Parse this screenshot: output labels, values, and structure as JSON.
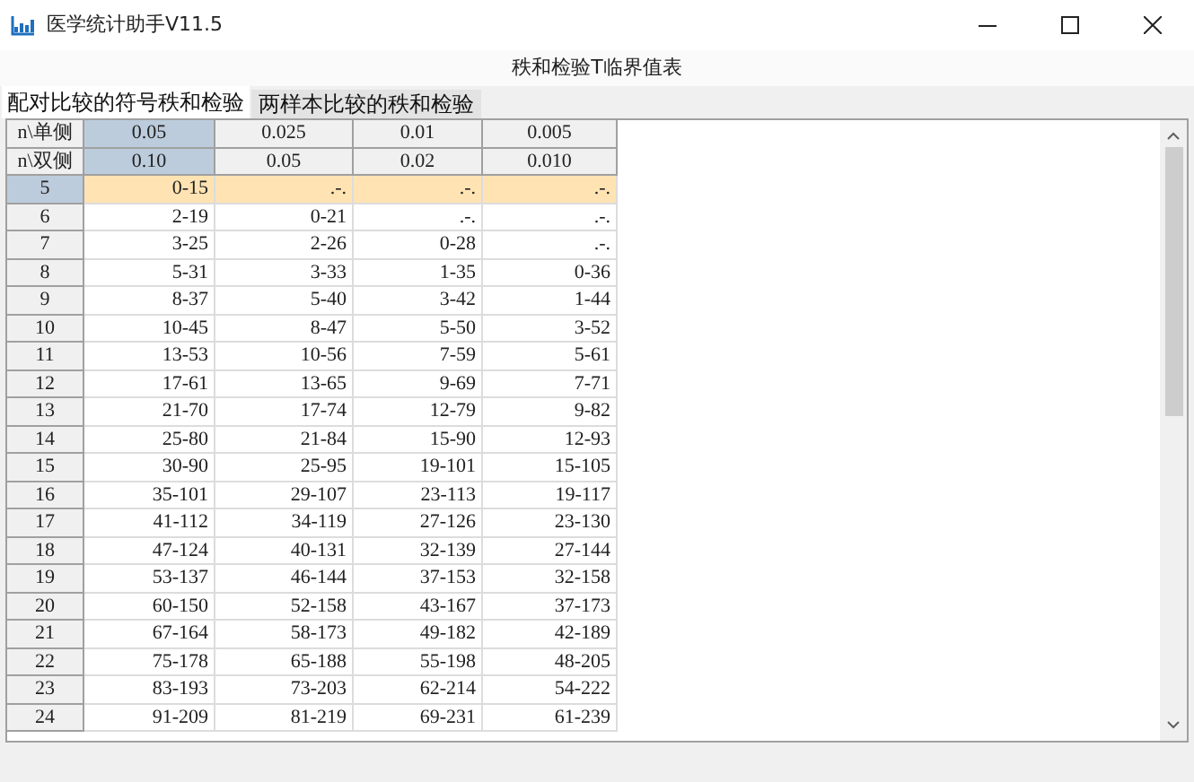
{
  "window": {
    "title": "医学统计助手V11.5"
  },
  "heading": "秩和检验T临界值表",
  "tabs": [
    {
      "label": "配对比较的符号秩和检验",
      "selected": true
    },
    {
      "label": "两样本比较的秩和检验",
      "selected": false
    }
  ],
  "table": {
    "row_labels": [
      "n\\单侧",
      "n\\双侧"
    ],
    "columns": [
      {
        "one_sided": "0.05",
        "two_sided": "0.10",
        "selected": true
      },
      {
        "one_sided": "0.025",
        "two_sided": "0.05",
        "selected": false
      },
      {
        "one_sided": "0.01",
        "two_sided": "0.02",
        "selected": false
      },
      {
        "one_sided": "0.005",
        "two_sided": "0.010",
        "selected": false
      }
    ],
    "rows": [
      {
        "n": "5",
        "values": [
          "0-15",
          ".-.",
          ".-.",
          ".-."
        ],
        "selected": true
      },
      {
        "n": "6",
        "values": [
          "2-19",
          "0-21",
          ".-.",
          ".-."
        ],
        "selected": false
      },
      {
        "n": "7",
        "values": [
          "3-25",
          "2-26",
          "0-28",
          ".-."
        ],
        "selected": false
      },
      {
        "n": "8",
        "values": [
          "5-31",
          "3-33",
          "1-35",
          "0-36"
        ],
        "selected": false
      },
      {
        "n": "9",
        "values": [
          "8-37",
          "5-40",
          "3-42",
          "1-44"
        ],
        "selected": false
      },
      {
        "n": "10",
        "values": [
          "10-45",
          "8-47",
          "5-50",
          "3-52"
        ],
        "selected": false
      },
      {
        "n": "11",
        "values": [
          "13-53",
          "10-56",
          "7-59",
          "5-61"
        ],
        "selected": false
      },
      {
        "n": "12",
        "values": [
          "17-61",
          "13-65",
          "9-69",
          "7-71"
        ],
        "selected": false
      },
      {
        "n": "13",
        "values": [
          "21-70",
          "17-74",
          "12-79",
          "9-82"
        ],
        "selected": false
      },
      {
        "n": "14",
        "values": [
          "25-80",
          "21-84",
          "15-90",
          "12-93"
        ],
        "selected": false
      },
      {
        "n": "15",
        "values": [
          "30-90",
          "25-95",
          "19-101",
          "15-105"
        ],
        "selected": false
      },
      {
        "n": "16",
        "values": [
          "35-101",
          "29-107",
          "23-113",
          "19-117"
        ],
        "selected": false
      },
      {
        "n": "17",
        "values": [
          "41-112",
          "34-119",
          "27-126",
          "23-130"
        ],
        "selected": false
      },
      {
        "n": "18",
        "values": [
          "47-124",
          "40-131",
          "32-139",
          "27-144"
        ],
        "selected": false
      },
      {
        "n": "19",
        "values": [
          "53-137",
          "46-144",
          "37-153",
          "32-158"
        ],
        "selected": false
      },
      {
        "n": "20",
        "values": [
          "60-150",
          "52-158",
          "43-167",
          "37-173"
        ],
        "selected": false
      },
      {
        "n": "21",
        "values": [
          "67-164",
          "58-173",
          "49-182",
          "42-189"
        ],
        "selected": false
      },
      {
        "n": "22",
        "values": [
          "75-178",
          "65-188",
          "55-198",
          "48-205"
        ],
        "selected": false
      },
      {
        "n": "23",
        "values": [
          "83-193",
          "73-203",
          "62-214",
          "54-222"
        ],
        "selected": false
      },
      {
        "n": "24",
        "values": [
          "91-209",
          "81-219",
          "69-231",
          "61-239"
        ],
        "selected": false
      }
    ]
  }
}
